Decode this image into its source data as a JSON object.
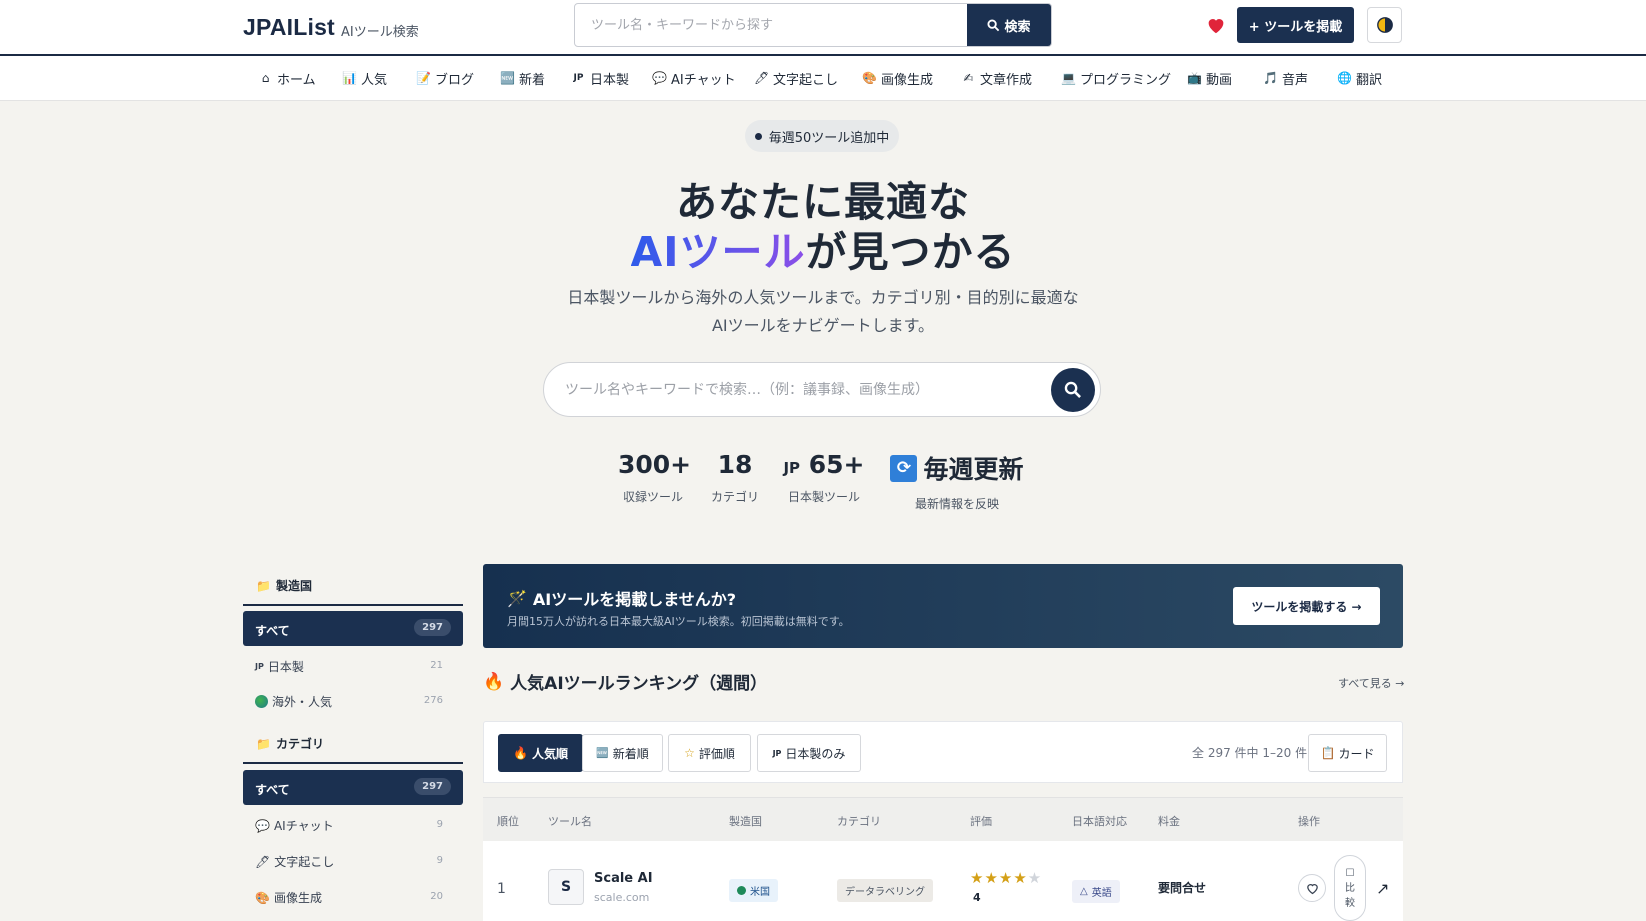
{
  "header": {
    "logo": "JPAIList",
    "logo_sub": "AIツール検索",
    "search_placeholder": "ツール名・キーワードから探す",
    "search_button": "検索",
    "post_button": "+ ツールを掲載"
  },
  "nav": [
    {
      "icon": "home-icon",
      "label": "ホーム"
    },
    {
      "icon": "chart-icon",
      "label": "人気"
    },
    {
      "icon": "memo-icon",
      "label": "ブログ"
    },
    {
      "icon": "new-icon",
      "label": "新着"
    },
    {
      "icon": "jp-flag-icon",
      "label": "日本製"
    },
    {
      "icon": "chat-icon",
      "label": "AIチャット"
    },
    {
      "icon": "pen-icon",
      "label": "文字起こし"
    },
    {
      "icon": "palette-icon",
      "label": "画像生成"
    },
    {
      "icon": "writing-icon",
      "label": "文章作成"
    },
    {
      "icon": "laptop-icon",
      "label": "プログラミング"
    },
    {
      "icon": "video-icon",
      "label": "動画"
    },
    {
      "icon": "music-icon",
      "label": "音声"
    },
    {
      "icon": "globe-icon",
      "label": "翻訳"
    }
  ],
  "hero": {
    "badge": "毎週50ツール追加中",
    "title_line1": "あなたに最適な",
    "title_highlight": "AIツール",
    "title_rest": "が見つかる",
    "subtitle_line1": "日本製ツールから海外の人気ツールまで。カテゴリ別・目的別に最適な",
    "subtitle_line2": "AIツールをナビゲートします。",
    "search_placeholder": "ツール名やキーワードで検索…（例：議事録、画像生成）"
  },
  "stats": [
    {
      "value": "300+",
      "label": "収録ツール"
    },
    {
      "value": "18",
      "label": "カテゴリ"
    },
    {
      "value": "65+",
      "prefix": "JP",
      "label": "日本製ツール"
    },
    {
      "value": "毎週更新",
      "label": "最新情報を反映"
    }
  ],
  "sidebar": {
    "country_heading": "製造国",
    "country_all": {
      "label": "すべて",
      "count": "297"
    },
    "country_items": [
      {
        "label": "日本製",
        "count": "21",
        "prefix": "JP"
      },
      {
        "label": "海外・人気",
        "count": "276"
      }
    ],
    "category_heading": "カテゴリ",
    "category_all": {
      "label": "すべて",
      "count": "297"
    },
    "category_items": [
      {
        "label": "AIチャット",
        "count": "9"
      },
      {
        "label": "文字起こし",
        "count": "9"
      },
      {
        "label": "画像生成",
        "count": "20"
      }
    ]
  },
  "banner": {
    "title": "AIツールを掲載しませんか?",
    "subtitle": "月間15万人が訪れる日本最大級AIツール検索。初回掲載は無料です。",
    "button": "ツールを掲載する →"
  },
  "ranking": {
    "title": "人気AIツールランキング（週間）",
    "see_all": "すべて見る →",
    "tabs": [
      {
        "label": "人気順",
        "active": true
      },
      {
        "label": "新着順"
      },
      {
        "label": "評価順"
      },
      {
        "label": "日本製のみ",
        "prefix": "JP"
      }
    ],
    "count_text": "全 297 件中 1–20 件",
    "view_button": "カード",
    "columns": [
      "順位",
      "ツール名",
      "製造国",
      "カテゴリ",
      "評価",
      "日本語対応",
      "料金",
      "操作"
    ],
    "rows": [
      {
        "rank": "1",
        "initial": "S",
        "name": "Scale AI",
        "domain": "scale.com",
        "country": "米国",
        "category": "データラベリング",
        "rating": 4,
        "rating_text": "4",
        "japanese": "英語",
        "price": "要問合せ",
        "compare": [
          "比",
          "較"
        ]
      }
    ]
  },
  "colors": {
    "navy": "#1b3050",
    "heart": "#e0243a",
    "gradient_start": "#2f5bea",
    "gradient_end": "#8b4fe8",
    "star": "#d4a017"
  }
}
